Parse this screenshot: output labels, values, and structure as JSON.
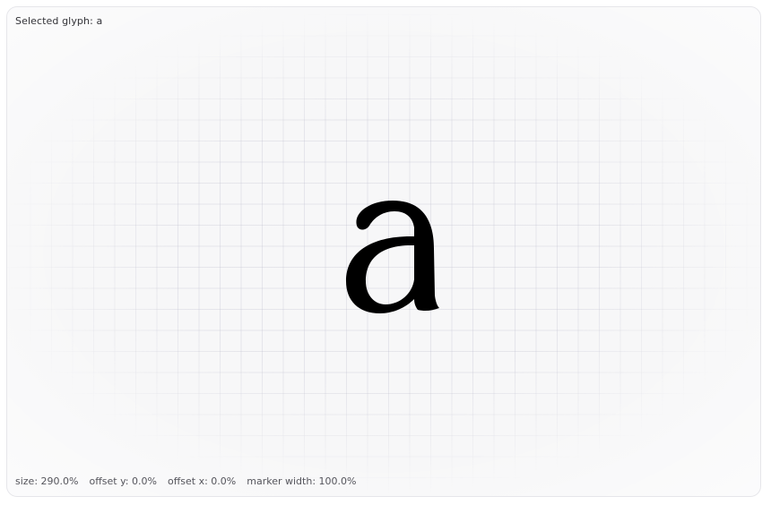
{
  "header": {
    "selected_label": "Selected glyph: a"
  },
  "glyph": {
    "character": "a",
    "color": "#000000"
  },
  "status": {
    "size": "size: 290.0%",
    "offset_y": "offset y: 0.0%",
    "offset_x": "offset x: 0.0%",
    "marker_width": "marker width: 100.0%"
  },
  "colors": {
    "frame_bg": "#f7f7f8",
    "frame_border": "#e6e6ea",
    "grid_line": "#aaaabe"
  }
}
